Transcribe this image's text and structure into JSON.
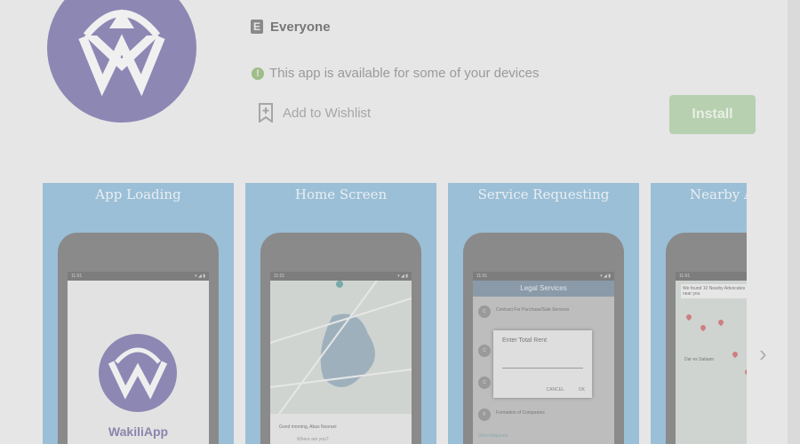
{
  "app": {
    "content_rating": "Everyone",
    "esrb_letter": "E",
    "availability": "This app is available for some of your devices",
    "wishlist_label": "Add to Wishlist",
    "install_label": "Install"
  },
  "screenshots": [
    {
      "title": "App Loading",
      "brand": "WakiliApp"
    },
    {
      "title": "Home Screen",
      "greeting": "Good morning, Abas Noorani",
      "search_placeholder": "Where are you?"
    },
    {
      "title": "Service Requesting",
      "header": "Legal Services",
      "dialog_title": "Enter Total Rent",
      "dialog_cancel": "CANCEL",
      "dialog_ok": "OK",
      "row_items": [
        "Contract For Purchase/Sale Services",
        "Formation of Companies"
      ],
      "footer": "View Requests"
    },
    {
      "title": "Nearby A",
      "banner": "We found 10 Nearby Advocates near you",
      "city": "Dar es Salaam"
    }
  ],
  "status_bar": {
    "time": "11:01"
  },
  "colors": {
    "brand_purple": "#8d87b4",
    "install_green": "#b7d0b0",
    "screenshot_bg": "#9bbfd6"
  }
}
